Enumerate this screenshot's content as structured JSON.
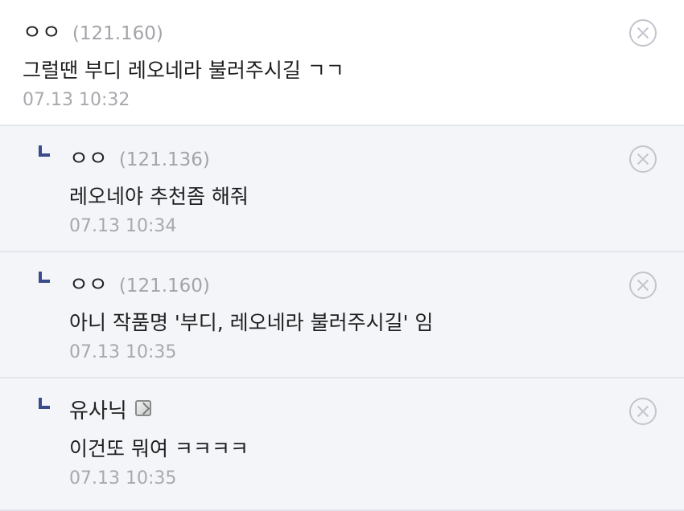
{
  "comments": [
    {
      "author": "ㅇㅇ",
      "ip": "(121.160)",
      "text": "그럴땐 부디 레오네라 불러주시길 ㄱㄱ",
      "date": "07.13 10:32"
    },
    {
      "author": "ㅇㅇ",
      "ip": "(121.136)",
      "text": "레오네야 추천좀 해줘",
      "date": "07.13 10:34"
    },
    {
      "author": "ㅇㅇ",
      "ip": "(121.160)",
      "text": "아니 작품명 '부디, 레오네라 불러주시길' 임",
      "date": "07.13 10:35"
    },
    {
      "author": "유사닉",
      "icon": "gonic-icon",
      "text": "이건또 뭐여 ㅋㅋㅋㅋ",
      "date": "07.13 10:35"
    }
  ],
  "colors": {
    "reply_bg": "#f4f5f9",
    "reply_arrow": "#3b4a8a",
    "meta_text": "#a8a8ae",
    "divider": "#e4e6ee"
  }
}
